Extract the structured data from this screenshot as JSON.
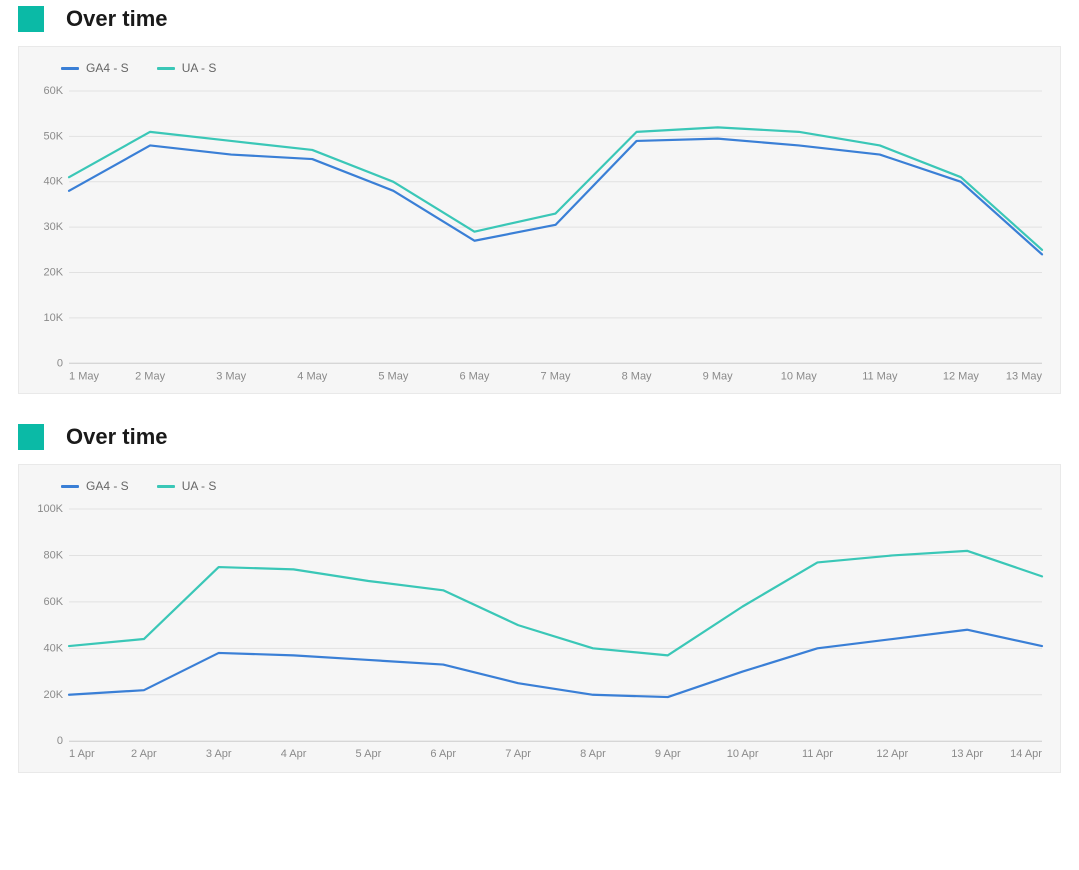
{
  "accent_color": "#0bbaa6",
  "series_colors": {
    "ga4": "#3a7fd6",
    "ua": "#3ac7b7"
  },
  "sections": [
    {
      "title": "Over time",
      "chart_ref": 0
    },
    {
      "title": "Over time",
      "chart_ref": 1
    }
  ],
  "chart_data": [
    {
      "type": "line",
      "title": "Over time",
      "xlabel": "",
      "ylabel": "",
      "ylim": [
        0,
        60000
      ],
      "y_ticks": [
        0,
        10000,
        20000,
        30000,
        40000,
        50000,
        60000
      ],
      "y_tick_labels": [
        "0",
        "10K",
        "20K",
        "30K",
        "40K",
        "50K",
        "60K"
      ],
      "categories": [
        "1 May",
        "2 May",
        "3 May",
        "4 May",
        "5 May",
        "6 May",
        "7 May",
        "8 May",
        "9 May",
        "10 May",
        "11 May",
        "12 May",
        "13 May"
      ],
      "series": [
        {
          "name": "GA4 - S",
          "color_key": "ga4",
          "values": [
            38000,
            48000,
            46000,
            45000,
            38000,
            27000,
            30500,
            49000,
            49500,
            48000,
            46000,
            40000,
            24000
          ]
        },
        {
          "name": "UA - S",
          "color_key": "ua",
          "values": [
            41000,
            51000,
            49000,
            47000,
            40000,
            29000,
            33000,
            51000,
            52000,
            51000,
            48000,
            41000,
            25000
          ]
        }
      ]
    },
    {
      "type": "line",
      "title": "Over time",
      "xlabel": "",
      "ylabel": "",
      "ylim": [
        0,
        100000
      ],
      "y_ticks": [
        0,
        20000,
        40000,
        60000,
        80000,
        100000
      ],
      "y_tick_labels": [
        "0",
        "20K",
        "40K",
        "60K",
        "80K",
        "100K"
      ],
      "categories": [
        "1 Apr",
        "2 Apr",
        "3 Apr",
        "4 Apr",
        "5 Apr",
        "6 Apr",
        "7 Apr",
        "8 Apr",
        "9 Apr",
        "10 Apr",
        "11 Apr",
        "12 Apr",
        "13 Apr",
        "14 Apr"
      ],
      "series": [
        {
          "name": "GA4 - S",
          "color_key": "ga4",
          "values": [
            20000,
            22000,
            38000,
            37000,
            35000,
            33000,
            25000,
            20000,
            19000,
            30000,
            40000,
            44000,
            48000,
            41000
          ]
        },
        {
          "name": "UA - S",
          "color_key": "ua",
          "values": [
            41000,
            44000,
            75000,
            74000,
            69000,
            65000,
            50000,
            40000,
            37000,
            58000,
            77000,
            80000,
            82000,
            71000
          ]
        }
      ]
    }
  ]
}
